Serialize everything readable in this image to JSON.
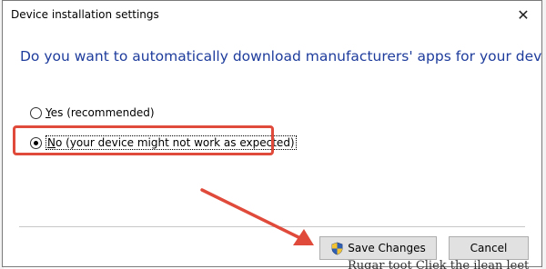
{
  "dialog": {
    "title": "Device installation settings",
    "question": "Do you want to automatically download manufacturers' apps for your devices?",
    "options": [
      {
        "label": "Yes (recommended)",
        "mnemonic": "Y",
        "rest": "es (recommended)",
        "selected": false
      },
      {
        "label": "No (your device might not work as expected)",
        "mnemonic": "N",
        "rest": "o (your device might not work as expected)",
        "selected": true
      }
    ],
    "save_label": "Save Changes",
    "cancel_label": "Cancel"
  },
  "background": {
    "text_bottom_right": "Rugar  toot  Cliek  the  ilean leet"
  },
  "icons": {
    "close": "close-icon",
    "shield": "uac-shield-icon"
  },
  "colors": {
    "question_text": "#1e3c9c",
    "annotation": "#e04a3a"
  }
}
